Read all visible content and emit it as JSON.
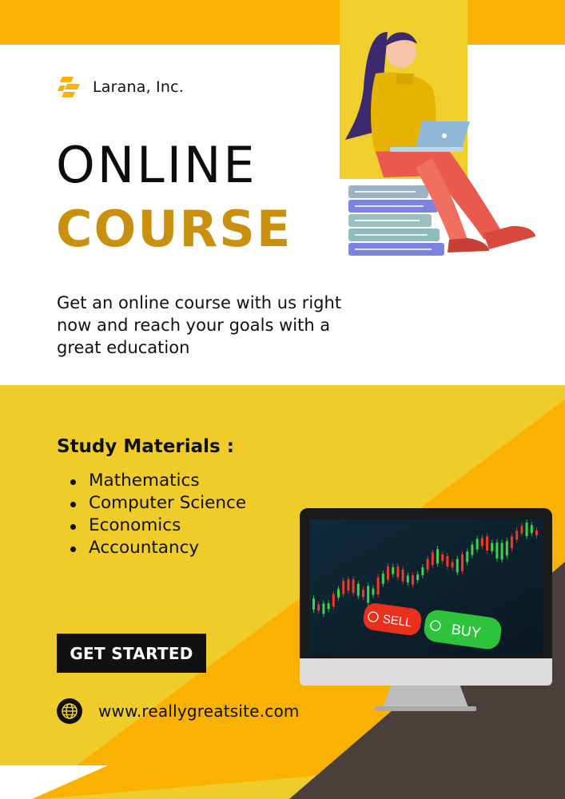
{
  "brand": {
    "name": "Larana, Inc.",
    "logo_icon": "stacked-bars-logo-icon"
  },
  "hero": {
    "title_line1": "ONLINE",
    "title_line2": "COURSE"
  },
  "description": "Get an online course with us right now and reach your goals with a great education",
  "materials": {
    "title": "Study Materials :",
    "items": [
      "Mathematics",
      "Computer Science",
      "Economics",
      "Accountancy"
    ]
  },
  "cta": {
    "label": "GET STARTED"
  },
  "website": {
    "url": "www.reallygreatsite.com",
    "icon": "globe-icon"
  },
  "monitor_screen": {
    "sell_label": "SELL",
    "buy_label": "BUY"
  },
  "colors": {
    "yellow": "#efcc2a",
    "orange": "#fbb100",
    "dark": "#4a3f3a",
    "gold_text": "#c8900d",
    "sell_red": "#e8301c",
    "buy_green": "#2ec33d"
  }
}
